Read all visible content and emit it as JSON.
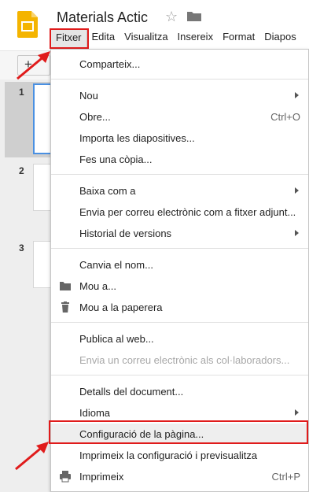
{
  "header": {
    "title": "Materials Actic",
    "star_icon": "star-outline-icon",
    "folder_icon": "folder-icon"
  },
  "menubar": [
    {
      "label": "Fitxer"
    },
    {
      "label": "Edita"
    },
    {
      "label": "Visualitza"
    },
    {
      "label": "Insereix"
    },
    {
      "label": "Format"
    },
    {
      "label": "Diapos"
    }
  ],
  "toolbar": {
    "add_label": "+"
  },
  "filmstrip": {
    "slides": [
      {
        "number": "1"
      },
      {
        "number": "2"
      },
      {
        "number": "3"
      }
    ]
  },
  "file_menu": {
    "items": [
      {
        "label": "Comparteix..."
      },
      {
        "label": "Nou",
        "submenu": true
      },
      {
        "label": "Obre...",
        "shortcut": "Ctrl+O"
      },
      {
        "label": "Importa les diapositives..."
      },
      {
        "label": "Fes una còpia..."
      },
      {
        "label": "Baixa com a",
        "submenu": true
      },
      {
        "label": "Envia per correu electrònic com a fitxer adjunt..."
      },
      {
        "label": "Historial de versions",
        "submenu": true
      },
      {
        "label": "Canvia el nom..."
      },
      {
        "label": "Mou a...",
        "icon": "folder-icon"
      },
      {
        "label": "Mou a la paperera",
        "icon": "trash-icon"
      },
      {
        "label": "Publica al web..."
      },
      {
        "label": "Envia un correu electrònic als col·laboradors...",
        "disabled": true
      },
      {
        "label": "Detalls del document..."
      },
      {
        "label": "Idioma",
        "submenu": true
      },
      {
        "label": "Configuració de la pàgina...",
        "highlighted": true
      },
      {
        "label": "Imprimeix la configuració i previsualitza"
      },
      {
        "label": "Imprimeix",
        "shortcut": "Ctrl+P",
        "icon": "printer-icon"
      }
    ]
  },
  "annotations": {
    "arrow_color": "#e01b1b",
    "highlight_color": "#e01b1b"
  }
}
